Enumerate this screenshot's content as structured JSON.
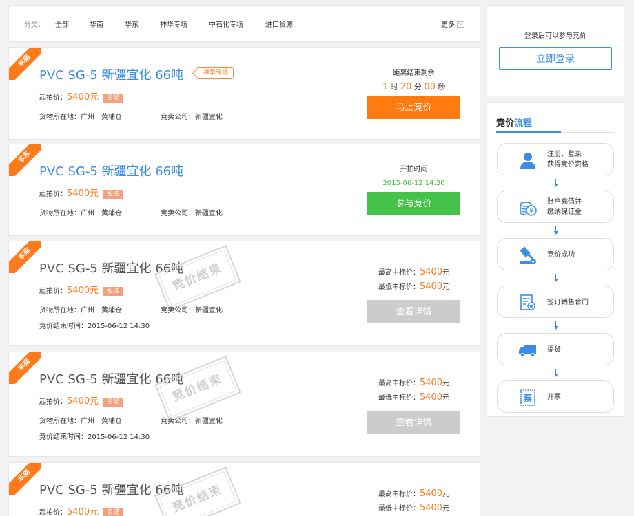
{
  "category_bar": {
    "label": "分类：",
    "items": [
      "全部",
      "华南",
      "华东",
      "神华专场",
      "中石化专场",
      "进口货源"
    ],
    "more_label": "更多"
  },
  "cards": [
    {
      "region": "华南",
      "title": "PVC SG-5 新疆宜化 66吨",
      "special_tag": "神华专场",
      "price_label": "起拍价：",
      "price": "5400元",
      "delivery_tag": "自提",
      "location": "货物所在地：广州　黄埔仓",
      "company": "竞卖公司：新疆宜化",
      "status": "countdown",
      "countdown_label": "距离结束剩余",
      "countdown": {
        "hours": "1",
        "h_unit": "时",
        "minutes": "20",
        "m_unit": "分",
        "seconds": "00",
        "s_unit": "秒"
      },
      "button_label": "马上竞价"
    },
    {
      "region": "华东",
      "title": "PVC SG-5 新疆宜化 66吨",
      "price_label": "起拍价：",
      "price": "5400元",
      "delivery_tag": "包送",
      "location": "货物所在地：广州　黄埔仓",
      "company": "竞卖公司：新疆宜化",
      "status": "upcoming",
      "start_label": "开拍时间",
      "start_time": "2015-06-12 14:30",
      "button_label": "参与竞价"
    },
    {
      "region": "华南",
      "title": "PVC SG-5 新疆宜化 66吨",
      "price_label": "起拍价：",
      "price": "5400元",
      "delivery_tag": "包送",
      "location": "货物所在地：广州　黄埔仓",
      "company": "竞卖公司：新疆宜化",
      "end_time": "竞价结束时间：2015-06-12 14:30",
      "status": "ended",
      "stamp_text": "竞价结束",
      "max_label": "最高中标价：",
      "max_price": "5400",
      "min_label": "最低中标价：",
      "min_price": "5400",
      "unit": "元",
      "button_label": "查看详情"
    },
    {
      "region": "华南",
      "title": "PVC SG-5 新疆宜化 66吨",
      "price_label": "起拍价：",
      "price": "5400元",
      "delivery_tag": "自提",
      "location": "货物所在地：广州　黄埔仓",
      "company": "竞卖公司：新疆宜化",
      "end_time": "竞价结束时间：2015-06-12 14:30",
      "status": "ended",
      "stamp_text": "竞价结束",
      "max_label": "最高中标价：",
      "max_price": "5400",
      "min_label": "最低中标价：",
      "min_price": "5400",
      "unit": "元",
      "button_label": "查看详情"
    },
    {
      "region": "华南",
      "title": "PVC SG-5 新疆宜化 66吨",
      "price_label": "起拍价：",
      "price": "5400元",
      "delivery_tag": "自提",
      "status": "ended",
      "stamp_text": "竞价结束",
      "max_label": "最高中标价：",
      "max_price": "5400",
      "min_label": "最低中标价：",
      "min_price": "5400",
      "unit": "元"
    }
  ],
  "sidebar": {
    "login_hint": "登录后可以参与竞价",
    "login_button": "立即登录",
    "flow_title_a": "竞价",
    "flow_title_b": "流程",
    "steps": [
      {
        "line1": "注册、登录",
        "line2": "获得竞价资格",
        "icon": "user-icon"
      },
      {
        "line1": "账户充值并",
        "line2": "缴纳保证金",
        "icon": "coins-icon"
      },
      {
        "line1": "竞价成功",
        "line2": "",
        "icon": "gavel-icon"
      },
      {
        "line1": "签订销售合同",
        "line2": "",
        "icon": "contract-icon"
      },
      {
        "line1": "提货",
        "line2": "",
        "icon": "truck-icon"
      },
      {
        "line1": "开票",
        "line2": "",
        "icon": "invoice-icon"
      }
    ]
  },
  "colors": {
    "accent": "#3a8ee6",
    "orange": "#ff7a0f",
    "green": "#44c24a",
    "gray": "#cccccc"
  }
}
